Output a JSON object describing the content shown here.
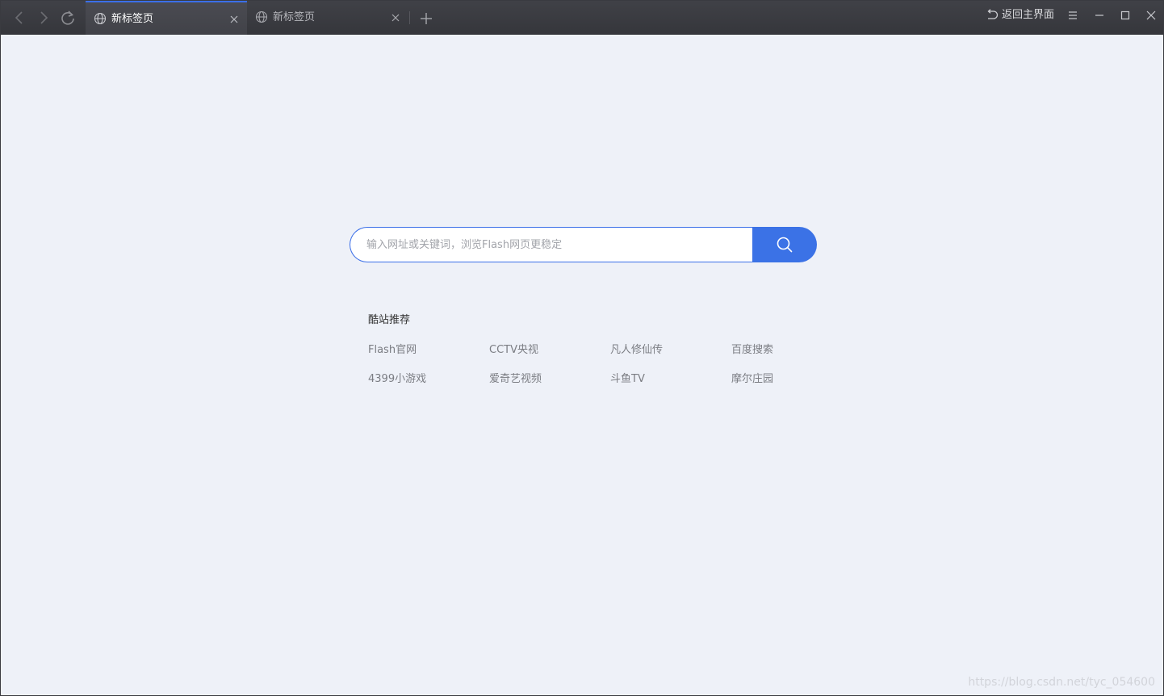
{
  "tabs": [
    {
      "label": "新标签页",
      "active": true
    },
    {
      "label": "新标签页",
      "active": false
    }
  ],
  "toolbar": {
    "home_label": "返回主界面"
  },
  "search": {
    "placeholder": "输入网址或关键词，浏览Flash网页更稳定",
    "value": ""
  },
  "recommend": {
    "title": "酷站推荐",
    "sites": [
      "Flash官网",
      "CCTV央视",
      "凡人修仙传",
      "百度搜索",
      "4399小游戏",
      "爱奇艺视频",
      "斗鱼TV",
      "摩尔庄园"
    ]
  },
  "watermark": "https://blog.csdn.net/tyc_054600",
  "colors": {
    "accent": "#3b72e6",
    "titlebar": "#3b3c41",
    "background": "#eef1f8"
  },
  "icons": [
    "back-icon",
    "forward-icon",
    "refresh-icon",
    "globe-icon",
    "close-icon",
    "plus-icon",
    "undo-icon",
    "menu-icon",
    "minimize-icon",
    "maximize-icon",
    "search-icon"
  ]
}
